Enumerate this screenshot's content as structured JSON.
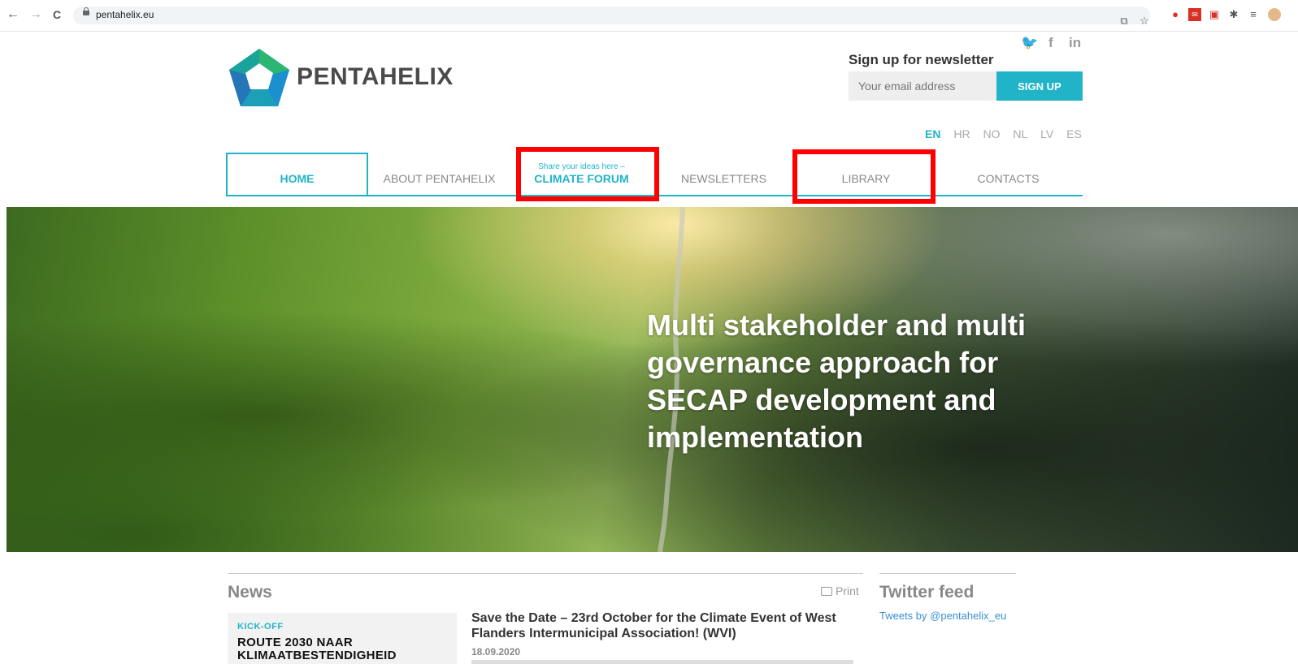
{
  "browser": {
    "url": "pentahelix.eu",
    "nav": {
      "back": "←",
      "forward": "→",
      "reload": "C"
    }
  },
  "header": {
    "logo_text": "PENTAHELIX",
    "social": {
      "twitter": "🐦",
      "facebook": "f",
      "linkedin": "in"
    },
    "newsletter": {
      "title": "Sign up for newsletter",
      "email_placeholder": "Your email address",
      "button_label": "SIGN UP"
    },
    "languages": [
      "EN",
      "HR",
      "NO",
      "NL",
      "LV",
      "ES"
    ],
    "active_language": "EN"
  },
  "nav": {
    "items": [
      {
        "label": "HOME"
      },
      {
        "label": "ABOUT PENTAHELIX"
      },
      {
        "sub_label": "Share your ideas here –",
        "label": "CLIMATE FORUM"
      },
      {
        "label": "NEWSLETTERS"
      },
      {
        "label": "LIBRARY"
      },
      {
        "label": "CONTACTS"
      }
    ],
    "active": "HOME"
  },
  "hero": {
    "title": "Multi stakeholder and multi governance approach for SECAP development and implementation"
  },
  "news": {
    "title": "News",
    "print_label": "Print",
    "item": {
      "thumb_tag": "KICK-OFF",
      "thumb_headline_1": "ROUTE 2030 NAAR",
      "thumb_headline_2": "KLIMAATBESTENDIGHEID",
      "headline": "Save the Date – 23rd October for the Climate Event of West Flanders Intermunicipal Association! (WVI)",
      "date": "18.09.2020"
    }
  },
  "twitter": {
    "title": "Twitter feed",
    "link_label": "Tweets by @pentahelix_eu"
  },
  "colors": {
    "accent": "#21b4c8",
    "highlight": "#ff0000",
    "text_dark": "#333333",
    "text_muted": "#888888"
  },
  "icons": [
    "back-arrow-icon",
    "forward-arrow-icon",
    "reload-icon",
    "lock-icon",
    "translate-icon",
    "star-icon",
    "twitter-icon",
    "facebook-icon",
    "linkedin-icon",
    "print-icon"
  ]
}
